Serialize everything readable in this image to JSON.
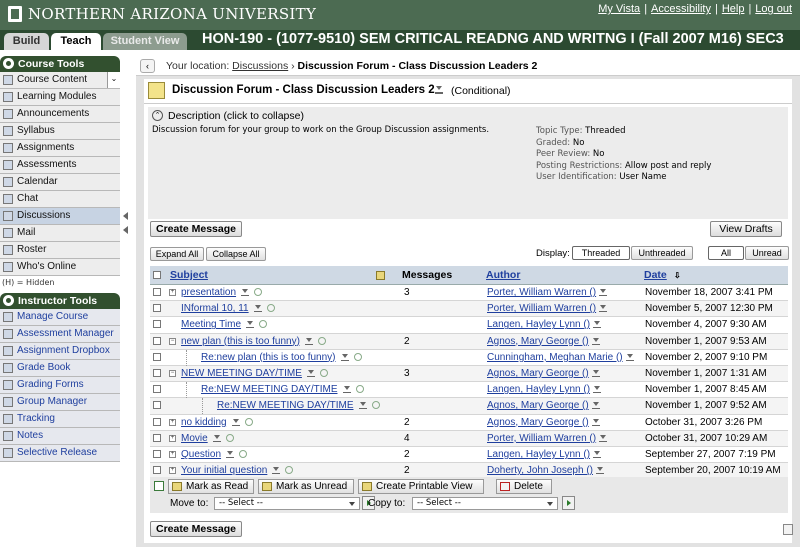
{
  "header": {
    "university": "NORTHERN ARIZONA UNIVERSITY",
    "links": [
      "My Vista",
      "Accessibility",
      "Help",
      "Log out"
    ],
    "tabs": [
      "Build",
      "Teach",
      "Student View"
    ],
    "course_title": "HON-190 - (1077-9510) SEM CRITICAL READNG AND WRITNG I (Fall 2007 M16) SEC3"
  },
  "sidebar": {
    "course_tools_title": "Course Tools",
    "course_tools": [
      "Course Content",
      "Learning Modules",
      "Announcements",
      "Syllabus",
      "Assignments",
      "Assessments",
      "Calendar",
      "Chat",
      "Discussions",
      "Mail",
      "Roster",
      "Who's Online"
    ],
    "hidden_note": "(H) = Hidden",
    "instructor_tools_title": "Instructor Tools",
    "instructor_tools": [
      "Manage Course",
      "Assessment Manager",
      "Assignment Dropbox",
      "Grade Book",
      "Grading Forms",
      "Group Manager",
      "Tracking",
      "Notes",
      "Selective Release"
    ]
  },
  "breadcrumb": {
    "prefix": "Your location:",
    "link": "Discussions",
    "current": "Discussion Forum - Class Discussion Leaders 2"
  },
  "forum": {
    "title": "Discussion Forum - Class Discussion Leaders 2",
    "conditional": "(Conditional)",
    "description_label": "Description (click to collapse)",
    "description_text": "Discussion forum for your group to work on the Group Discussion assignments.",
    "properties": [
      {
        "key": "Topic Type:",
        "value": "Threaded"
      },
      {
        "key": "Graded:",
        "value": "No"
      },
      {
        "key": "Peer Review:",
        "value": "No"
      },
      {
        "key": "Posting Restrictions:",
        "value": "Allow post and reply"
      },
      {
        "key": "User Identification:",
        "value": "User Name"
      }
    ]
  },
  "toolbar": {
    "create_message": "Create Message",
    "view_drafts": "View Drafts",
    "expand_all": "Expand All",
    "collapse_all": "Collapse All",
    "display_label": "Display:",
    "threaded": "Threaded",
    "unthreaded": "Unthreaded",
    "all": "All",
    "unread": "Unread"
  },
  "table": {
    "headers": {
      "subject": "Subject",
      "messages": "Messages",
      "author": "Author",
      "date": "Date"
    },
    "rows": [
      {
        "subject": "presentation",
        "messages": "3",
        "author": "Porter, William Warren ()",
        "date": "November 18, 2007 3:41 PM",
        "level": 0,
        "expander": "+"
      },
      {
        "subject": "INformal 10, 11",
        "messages": "",
        "author": "Porter, William Warren ()",
        "date": "November 5, 2007 12:30 PM",
        "level": 0,
        "expander": ""
      },
      {
        "subject": "Meeting Time",
        "messages": "",
        "author": "Langen, Hayley Lynn ()",
        "date": "November 4, 2007 9:30 AM",
        "level": 0,
        "expander": ""
      },
      {
        "subject": "new plan (this is too funny)",
        "messages": "2",
        "author": "Agnos, Mary George ()",
        "date": "November 1, 2007 9:53 AM",
        "level": 0,
        "expander": "-"
      },
      {
        "subject": "Re:new plan (this is too funny)",
        "messages": "",
        "author": "Cunningham, Meghan Marie ()",
        "date": "November 2, 2007 9:10 PM",
        "level": 1,
        "expander": ""
      },
      {
        "subject": "NEW MEETING DAY/TIME",
        "messages": "3",
        "author": "Agnos, Mary George ()",
        "date": "November 1, 2007 1:31 AM",
        "level": 0,
        "expander": "-"
      },
      {
        "subject": "Re:NEW MEETING DAY/TIME",
        "messages": "",
        "author": "Langen, Hayley Lynn ()",
        "date": "November 1, 2007 8:45 AM",
        "level": 1,
        "expander": ""
      },
      {
        "subject": "Re:NEW MEETING DAY/TIME",
        "messages": "",
        "author": "Agnos, Mary George ()",
        "date": "November 1, 2007 9:52 AM",
        "level": 2,
        "expander": ""
      },
      {
        "subject": "no kidding",
        "messages": "2",
        "author": "Agnos, Mary George ()",
        "date": "October 31, 2007 3:26 PM",
        "level": 0,
        "expander": "+"
      },
      {
        "subject": "Movie",
        "messages": "4",
        "author": "Porter, William Warren ()",
        "date": "October 31, 2007 10:29 AM",
        "level": 0,
        "expander": "+"
      },
      {
        "subject": "Question",
        "messages": "2",
        "author": "Langen, Hayley Lynn ()",
        "date": "September 27, 2007 7:19 PM",
        "level": 0,
        "expander": "+"
      },
      {
        "subject": "Your initial question",
        "messages": "2",
        "author": "Doherty, John Joseph ()",
        "date": "September 20, 2007 10:19 AM",
        "level": 0,
        "expander": "+"
      }
    ]
  },
  "actions": {
    "mark_read": "Mark as Read",
    "mark_unread": "Mark as Unread",
    "create_printable": "Create Printable View",
    "delete": "Delete",
    "move_to": "Move to:",
    "copy_to": "Copy to:",
    "select_placeholder": "-- Select --"
  }
}
